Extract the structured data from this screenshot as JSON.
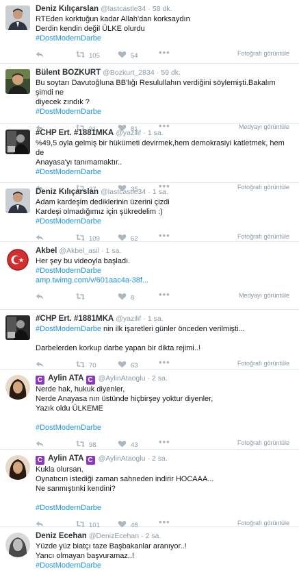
{
  "tweets": [
    {
      "fullname": "Deniz Kılıçarslan",
      "username": "@lastcastle34",
      "dot": "·",
      "time": "58 dk.",
      "lines": [
        "RTEden korktuğun kadar Allah'dan korksaydın",
        "Derdin kendin değil ÜLKE olurdu"
      ],
      "hashtag": "#DostModernDarbe",
      "retweets": "105",
      "likes": "54",
      "media_link": "Fotoğrafı görüntüle"
    },
    {
      "fullname": "Bülent BOZKURT",
      "username": "@Bozkurt_2834",
      "dot": "·",
      "time": "59 dk.",
      "lines": [
        "Bu soytarı Davutoğluna BB'lığı Resulullahın verdiğini söylemişti.Bakalım şimdi ne",
        "diyecek zındık ?"
      ],
      "hashtag": "#DostModernDarbe",
      "retweets": "91",
      "likes": "81",
      "media_link": "Medyayı görüntüle"
    },
    {
      "fullname": "#CHP Ert. #1881MKA",
      "username": "@yazilif",
      "dot": "·",
      "time": "1 sa.",
      "lines": [
        "%49,5 oyla gelmiş bir hükümeti devirmek,hem demokrasiyi katletmek, hem de",
        "Anayasa'yı tanımamaktır.."
      ],
      "hashtag": "#DostModernDarbe",
      "retweets": "27",
      "likes": "35",
      "media_link": "Fotoğrafı görüntüle"
    },
    {
      "fullname": "Deniz Kılıçarslan",
      "username": "@lastcastle34",
      "dot": "·",
      "time": "1 sa.",
      "lines": [
        "Adam kardeşim dediklerinin üzerini çizdi",
        "Kardeşi olmadığımız için şükredelim :)"
      ],
      "hashtag": "#DostModernDarbe",
      "retweets": "109",
      "likes": "62",
      "media_link": "Fotoğrafı görüntüle"
    },
    {
      "fullname": "Akbel",
      "username": "@Akbel_asil",
      "dot": "·",
      "time": "1 sa.",
      "lines": [
        "Her şey bu videoyla başladı."
      ],
      "hashtag": "#DostModernDarbe",
      "link": "amp.twimg.com/v/601aac4a-38f...",
      "retweets": "",
      "likes": "8",
      "media_link": "Medyayı görüntüle"
    },
    {
      "fullname": "#CHP Ert. #1881MKA",
      "username": "@yazilif",
      "dot": "·",
      "time": "1 sa.",
      "hashtag_inline": "#DostModernDarbe",
      "inline_rest": " nin ilk işaretleri günler önceden verilmişti...",
      "lines_after": [
        "",
        "Darbelerden korkup darbe yapan bir dikta rejimi..!"
      ],
      "retweets": "70",
      "likes": "63",
      "media_link": "Fotoğrafı görüntüle"
    },
    {
      "emoji": "C",
      "fullname": "Aylin ATA",
      "emoji2": "C",
      "username": "@AylinAtaoglu",
      "dot": "·",
      "time": "2 sa.",
      "lines": [
        "Nerde hak, hukuk diyenler,",
        "Nerde Anayasa nın üstünde hiçbirşey yoktur diyenler,",
        "Yazık oldu ÜLKEME",
        ""
      ],
      "hashtag": "#DostModernDarbe",
      "retweets": "98",
      "likes": "43",
      "media_link": "Fotoğrafı görüntüle"
    },
    {
      "emoji": "C",
      "fullname": "Aylin ATA",
      "emoji2": "C",
      "username": "@AylinAtaoglu",
      "dot": "·",
      "time": "2 sa.",
      "lines": [
        "Kukla olursan,",
        "Oynatıcın istediği zaman sahneden indirir HOCAAA...",
        "Ne sanmıştınki kendini?",
        ""
      ],
      "hashtag": "#DostModernDarbe",
      "retweets": "101",
      "likes": "48",
      "media_link": "Fotoğrafı görüntüle"
    },
    {
      "fullname": "Deniz Ecehan",
      "username": "@DenizEcehan",
      "dot": "·",
      "time": "2 sa.",
      "lines": [
        "Yüzde yüz biatçı taze Başbakanlar aranıyor..!",
        "Yancı olmayan başvuramaz..!"
      ],
      "hashtag": "#DostModernDarbe"
    }
  ]
}
